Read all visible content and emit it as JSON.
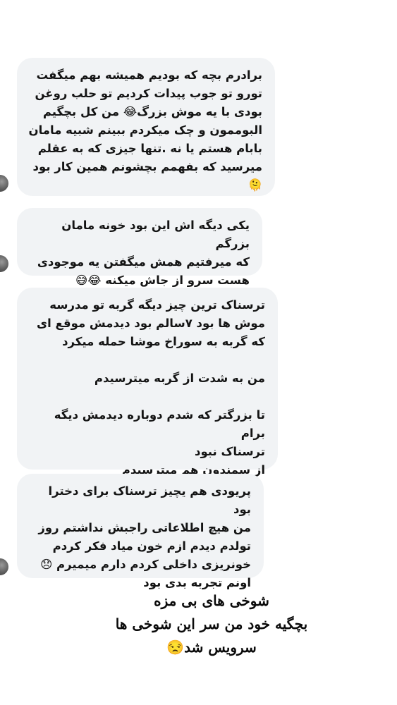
{
  "messages": [
    {
      "text": "برادرم بچه که بودیم همیشه بهم میگفت\nتورو تو جوب پیدات کردیم تو حلب روغن\nبودی با یه موش بزرگ😂 من کل بچگیم\nالبوممون و چک میکردم ببینم شبیه مامان\nبابام هستم یا نه .تنها جیزی که به عقلم\nمیرسید که بفهمم بچشونم همین کار بود\n🫠"
    },
    {
      "text": "یکی دیگه اش این بود خونه مامان بزرگم\nکه میرفتیم همش میگفتن یه موجودی\nهست سرو از جاش میکنه 😂😅"
    },
    {
      "text": "ترسناک ترین چیز دیگه گربه تو مدرسه\nموش ها بود  ۷سالم بود دیدمش موقع ای\nکه گربه به سوراخ موشا حمله میکرد\n\nمن به شدت از گربه میترسیدم\n\nتا بزرگتر که شدم دوباره دیدمش  دیگه برام\nترسناک نبود\nاز سمندون هم میترسیدم"
    },
    {
      "text": "پریودی هم یچیز ترسناک برای دخترا بود\nمن  هیچ اطلاعاتی راجبش نداشتم روز\nتولدم دیدم ازم خون میاد فکر کردم\nخونریزی داخلی کردم دارم میمیرم 😞\nاونم تجربه بدی بود"
    }
  ],
  "caption": "شوخی های بی مزه\nبچگیه خود من سر این شوخی ها\nسرویس شد😒"
}
